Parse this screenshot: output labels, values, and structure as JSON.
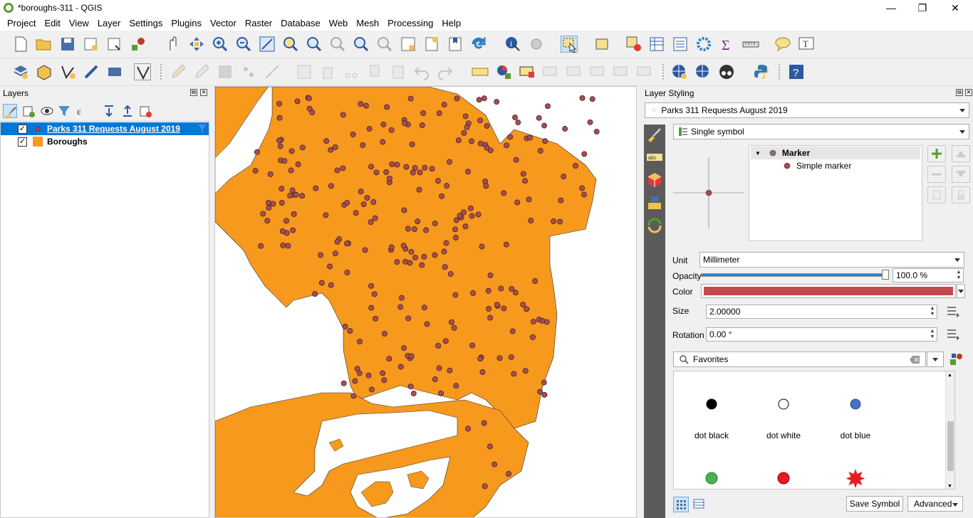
{
  "window": {
    "title": "*boroughs-311 - QGIS",
    "minimize": "—",
    "maximize": "❐",
    "close": "✕"
  },
  "menu": [
    "Project",
    "Edit",
    "View",
    "Layer",
    "Settings",
    "Plugins",
    "Vector",
    "Raster",
    "Database",
    "Web",
    "Mesh",
    "Processing",
    "Help"
  ],
  "layers_panel": {
    "title": "Layers",
    "layers": [
      {
        "name": "Parks 311 Requests August 2019",
        "checked": true,
        "selected": true,
        "symbol_color": "#b5454c"
      },
      {
        "name": "Boroughs",
        "checked": true,
        "selected": false,
        "symbol_color": "#f89a1c"
      }
    ]
  },
  "map": {
    "land_color": "#f7991d",
    "point_color": "#b14a50"
  },
  "styling_panel": {
    "title": "Layer Styling",
    "layer_combo": "Parks 311 Requests August 2019",
    "renderer_combo": "Single symbol",
    "tree": {
      "root": "Marker",
      "child": "Simple marker"
    },
    "unit_label": "Unit",
    "unit_value": "Millimeter",
    "opacity_label": "Opacity",
    "opacity_value": "100.0 %",
    "opacity_fraction": 1.0,
    "color_label": "Color",
    "color_value": "#c44a4f",
    "size_label": "Size",
    "size_value": "2.00000",
    "rotation_label": "Rotation",
    "rotation_value": "0.00 °",
    "search_value": "Favorites",
    "library": [
      {
        "label": "dot  black",
        "color": "#000000",
        "kind": "dot"
      },
      {
        "label": "dot  white",
        "color": "#ffffff",
        "kind": "dot"
      },
      {
        "label": "dot  blue",
        "color": "#4472c4",
        "kind": "dot"
      },
      {
        "label": "",
        "color": "#4caf50",
        "kind": "dot"
      },
      {
        "label": "",
        "color": "#e51c23",
        "kind": "dot"
      },
      {
        "label": "",
        "color": "#e51c23",
        "kind": "star"
      }
    ],
    "save_symbol": "Save Symbol",
    "advanced": "Advanced"
  }
}
